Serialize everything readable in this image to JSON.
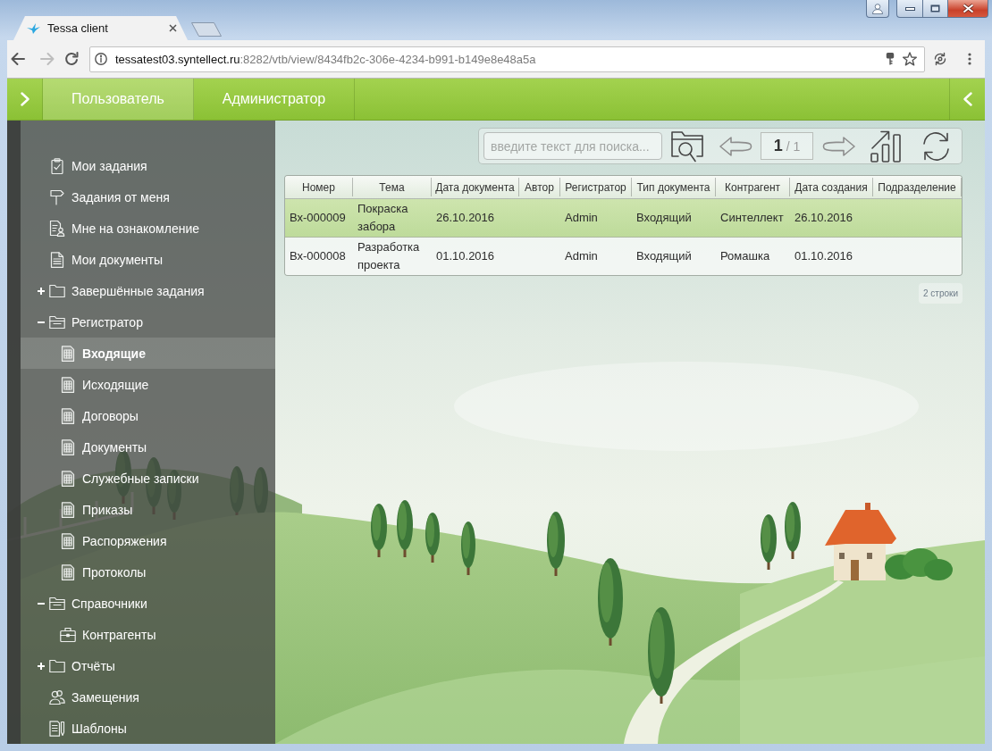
{
  "browser": {
    "tabs": [
      {
        "title": "Tessa client",
        "selected": true
      }
    ],
    "navigation": {
      "back": {
        "disabled": false
      },
      "forward": {
        "disabled": true
      }
    },
    "address": {
      "host": "tessatest03.syntellect.ru",
      "path": ":8282/vtb/view/8434fb2c-306e-4234-b991-b149e8e48a5a"
    }
  },
  "top_bar": {
    "tabs": [
      {
        "label": "Пользователь",
        "selected": true
      },
      {
        "label": "Администратор",
        "selected": false
      }
    ]
  },
  "sidebar": {
    "items": [
      {
        "kind": "tasks",
        "label": "Мои задания",
        "selected": false
      },
      {
        "kind": "assigned",
        "label": "Задания от меня",
        "selected": false
      },
      {
        "kind": "acquaintance",
        "label": "Мне на ознакомление",
        "selected": false
      },
      {
        "kind": "documents",
        "label": "Мои документы",
        "selected": false
      },
      {
        "kind": "folder",
        "label": "Завершённые задания",
        "selected": false,
        "expanded": false
      },
      {
        "kind": "folder",
        "label": "Регистратор",
        "selected": false,
        "expanded": true,
        "children": [
          {
            "kind": "card",
            "label": "Входящие",
            "selected": true
          },
          {
            "kind": "card",
            "label": "Исходящие",
            "selected": false
          },
          {
            "kind": "card",
            "label": "Договоры",
            "selected": false
          },
          {
            "kind": "card",
            "label": "Документы",
            "selected": false
          },
          {
            "kind": "card",
            "label": "Служебные записки",
            "selected": false
          },
          {
            "kind": "card",
            "label": "Приказы",
            "selected": false
          },
          {
            "kind": "card",
            "label": "Распоряжения",
            "selected": false
          },
          {
            "kind": "card",
            "label": "Протоколы",
            "selected": false
          }
        ]
      },
      {
        "kind": "folder",
        "label": "Справочники",
        "selected": false,
        "expanded": true,
        "children": [
          {
            "kind": "partners",
            "label": "Контрагенты",
            "selected": false
          }
        ]
      },
      {
        "kind": "folder",
        "label": "Отчёты",
        "selected": false,
        "expanded": false
      },
      {
        "kind": "deputies",
        "label": "Замещения",
        "selected": false
      },
      {
        "kind": "templates",
        "label": "Шаблоны",
        "selected": false
      }
    ]
  },
  "toolbar": {
    "search": {
      "placeholder": "введите текст для поиска..."
    },
    "previous": {
      "disabled": true
    },
    "pager": "**1** / 1",
    "next": {
      "disabled": true
    }
  },
  "table": {
    "columns": [
      "Номер",
      "Тема",
      "Дата документа",
      "Автор",
      "Регистратор",
      "Тип документа",
      "Контрагент",
      "Дата создания",
      "Подразделение"
    ],
    "rows": [
      {
        "selected": true,
        "number": "Вх-000009",
        "subject": "Покраска забора",
        "document_date": "26.10.2016",
        "registrar": "Admin",
        "document_type": "Входящий",
        "counterparty": "Синтеллект",
        "created": "26.10.2016"
      },
      {
        "selected": false,
        "number": "Вх-000008",
        "subject": "Разработка проекта",
        "document_date": "01.10.2016",
        "registrar": "Admin",
        "document_type": "Входящий",
        "counterparty": "Ромашка",
        "created": "01.10.2016"
      }
    ]
  },
  "status": {
    "row_count": "2 строки"
  }
}
